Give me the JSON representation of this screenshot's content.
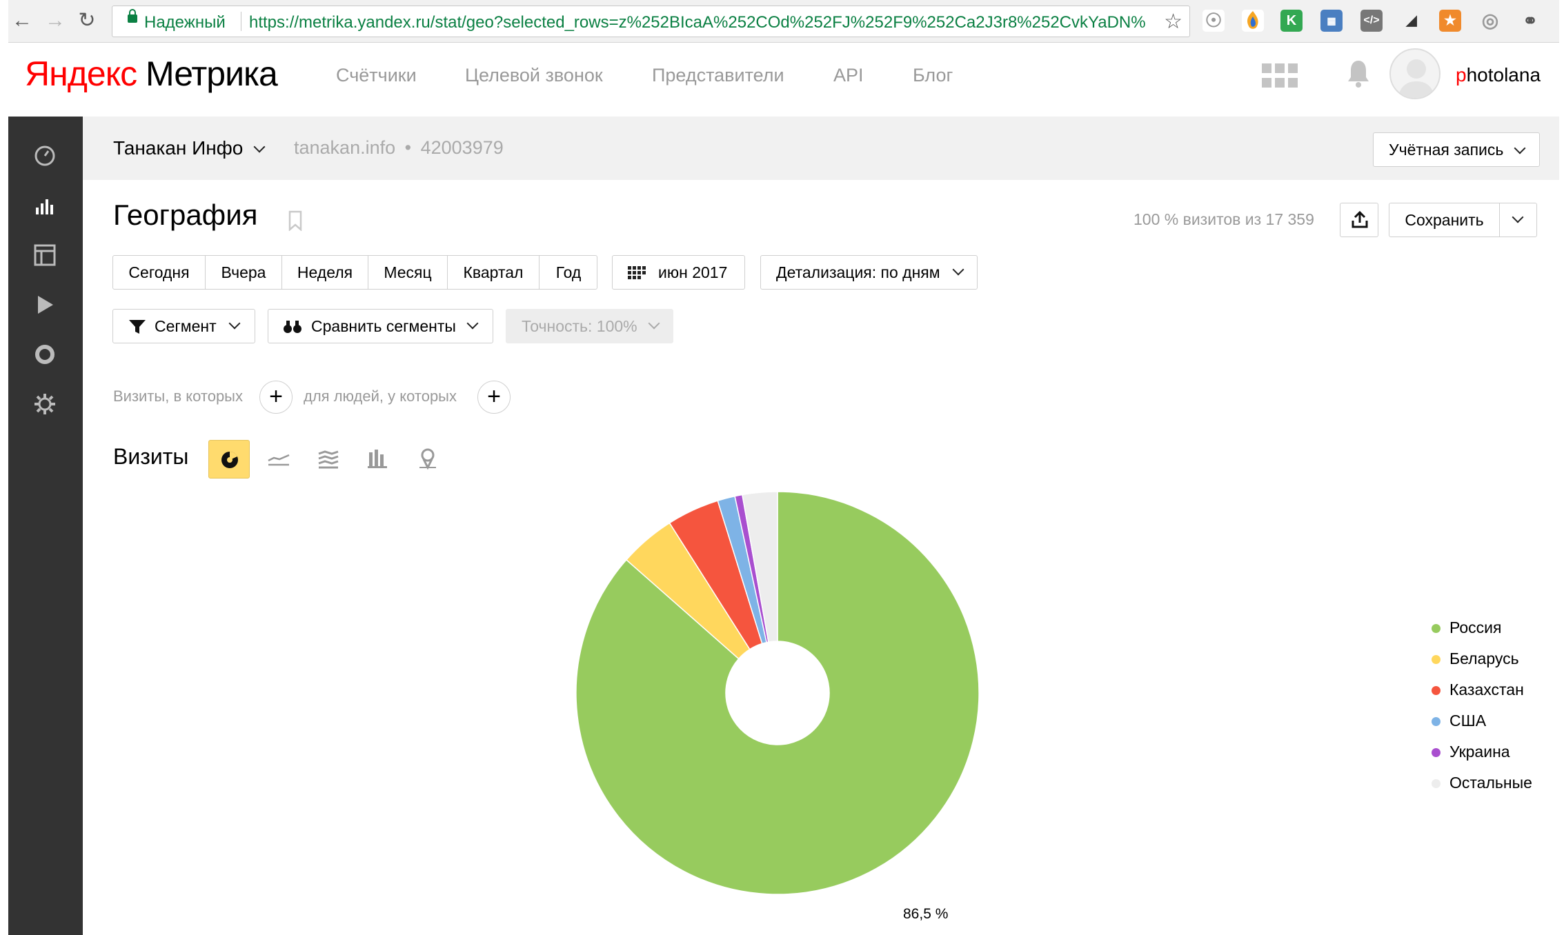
{
  "browser": {
    "secure_label": "Надежный",
    "url": "https://metrika.yandex.ru/stat/geo?selected_rows=z%252BIcaA%252COd%252FJ%252F9%252Ca2J3r8%252CvkYaDN%"
  },
  "header": {
    "logo_yandex": "Яндекс",
    "logo_metrika": "Метрика",
    "nav": [
      "Счётчики",
      "Целевой звонок",
      "Представители",
      "API",
      "Блог"
    ],
    "username_first": "p",
    "username_rest": "hotolana"
  },
  "counter": {
    "name": "Танакан Инфо",
    "domain": "tanakan.info",
    "separator": "•",
    "id": "42003979",
    "account_label": "Учётная запись"
  },
  "page": {
    "title": "География",
    "visits_share": "100 % визитов из 17 359",
    "save_label": "Сохранить"
  },
  "periods": [
    "Сегодня",
    "Вчера",
    "Неделя",
    "Месяц",
    "Квартал",
    "Год"
  ],
  "date_label": "июн 2017",
  "detail_label": "Детализация: по дням",
  "segment_label": "Сегмент",
  "compare_label": "Сравнить сегменты",
  "accuracy_label": "Точность: 100%",
  "filter_hints": {
    "visits": "Визиты, в которых",
    "people": "для людей, у которых"
  },
  "metric_label": "Визиты",
  "chart_data": {
    "type": "pie",
    "donut": true,
    "categories": [
      "Россия",
      "Беларусь",
      "Казахстан",
      "США",
      "Украина",
      "Остальные"
    ],
    "values": [
      86.5,
      4.5,
      4.2,
      1.4,
      0.6,
      2.8
    ],
    "colors": [
      "#97cb5e",
      "#ffd75d",
      "#f5553e",
      "#7eb3e6",
      "#a94fcf",
      "#ededed"
    ],
    "data_labels": [
      "86,5 %"
    ],
    "legend_position": "right"
  },
  "colors": {
    "sidebar_bg": "#333333",
    "active_viz_bg": "#ffdb6e",
    "brand_red": "#ff0000"
  }
}
